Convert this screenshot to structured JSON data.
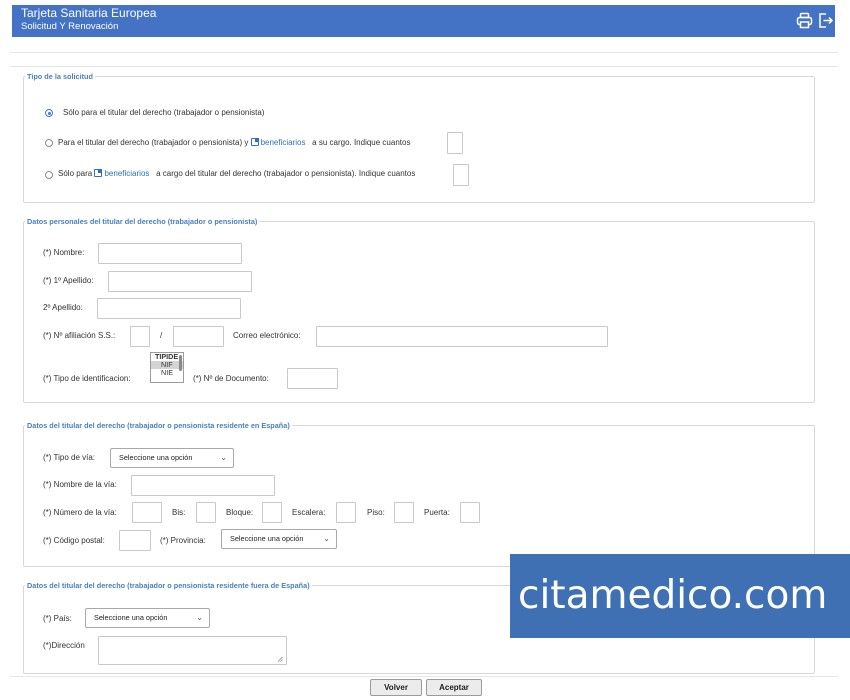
{
  "header": {
    "title": "Tarjeta Sanitaria Europea",
    "subtitle": "Solicitud Y Renovación",
    "icons": [
      "print-icon",
      "logout-icon"
    ],
    "color": "#4472c4"
  },
  "tipo_solicitud": {
    "legend": "Tipo de la solicitud",
    "opt1": "Sólo para el titular del derecho (trabajador o pensionista)",
    "opt2_pre": "Para el titular del derecho (trabajador o pensionista) y",
    "opt2_link": "beneficiarios",
    "opt2_post": "a su cargo. Indique cuantos",
    "opt3_pre": "Sólo para",
    "opt3_link": "beneficiarios",
    "opt3_post": "a cargo del titular del derecho (trabajador o pensionista). Indique cuantos",
    "selected_option": 1
  },
  "datos_personales": {
    "legend": "Datos personales del titular del derecho (trabajador o pensionista)",
    "nombre": "(*) Nombre:",
    "apellido1": "(*) 1º Apellido:",
    "apellido2": "2º Apellido:",
    "afiliacion": "(*) Nº afiliación S.S.:",
    "slash": "/",
    "correo": "Correo electrónico:",
    "tipo_id": "(*) Tipo de identificacion:",
    "tipo_id_options": [
      "TIPIDE",
      "NIF",
      "NIE"
    ],
    "tipo_id_selected": "NIF",
    "num_documento": "(*) Nº de Documento:"
  },
  "residente_espana": {
    "legend": "Datos del titular del derecho (trabajador o pensionista residente en España)",
    "tipo_via": "(*) Tipo de vía:",
    "tipo_via_value": "Seleccione una opción",
    "nombre_via": "(*) Nombre de la vía:",
    "numero_via": "(*) Número de la vía:",
    "bis": "Bis:",
    "bloque": "Bloque:",
    "escalera": "Escalera:",
    "piso": "Piso:",
    "puerta": "Puerta:",
    "codigo_postal": "(*) Código postal:",
    "provincia": "(*) Provincia:",
    "provincia_value": "Seleccione una opción"
  },
  "residente_fuera": {
    "legend": "Datos del titular del derecho (trabajador o pensionista residente fuera de España)",
    "pais": "(*) País:",
    "pais_value": "Seleccione una opción",
    "direccion": "(*)Dirección"
  },
  "buttons": {
    "volver": "Volver",
    "aceptar": "Aceptar"
  },
  "watermark": {
    "text": "citamedico.com",
    "color": "#3f70b3"
  }
}
